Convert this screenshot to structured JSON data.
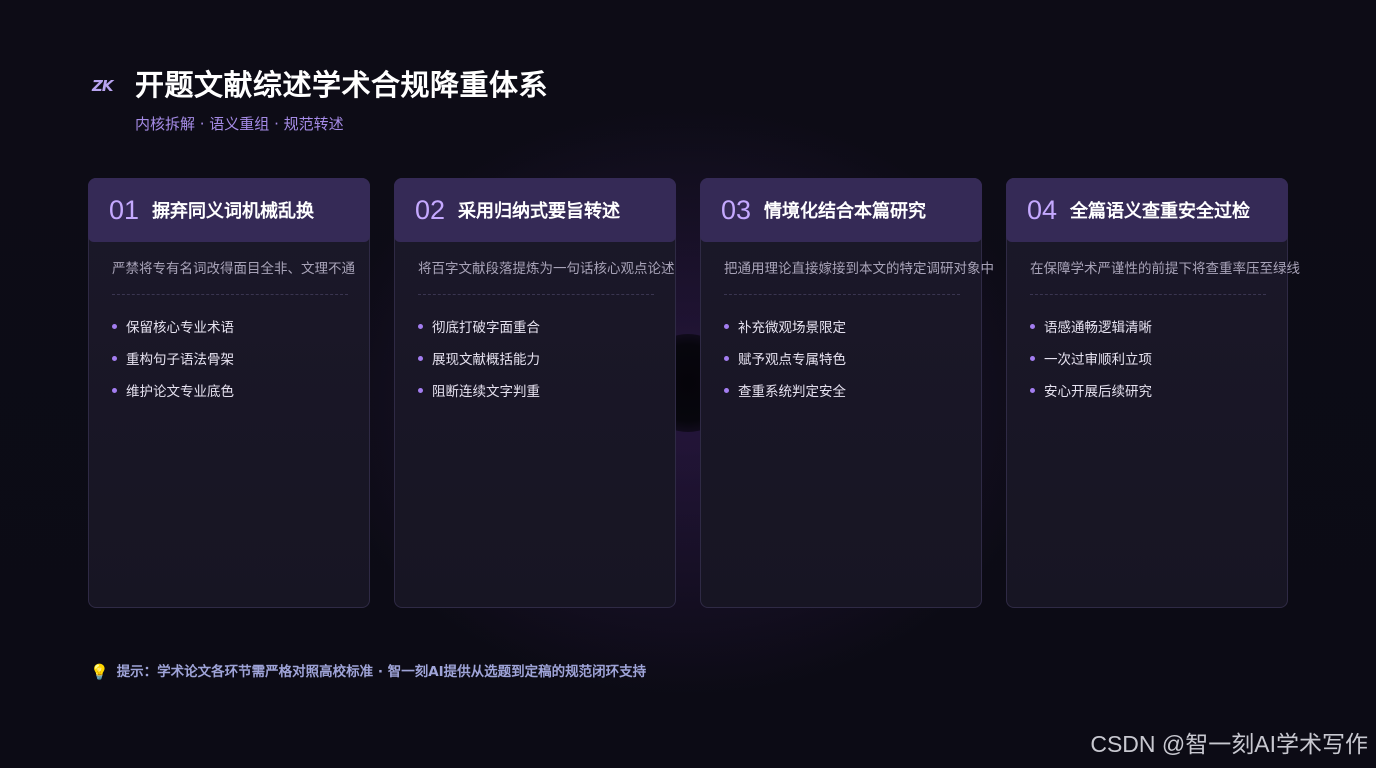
{
  "header": {
    "logo": "ZK",
    "title": "开题文献综述学术合规降重体系",
    "subtitle": "内核拆解 · 语义重组 · 规范转述"
  },
  "cards": [
    {
      "num": "01",
      "title": "摒弃同义词机械乱换",
      "desc": "严禁将专有名词改得面目全非、文理不通",
      "points": [
        "保留核心专业术语",
        "重构句子语法骨架",
        "维护论文专业底色"
      ]
    },
    {
      "num": "02",
      "title": "采用归纳式要旨转述",
      "desc": "将百字文献段落提炼为一句话核心观点论述",
      "points": [
        "彻底打破字面重合",
        "展现文献概括能力",
        "阻断连续文字判重"
      ]
    },
    {
      "num": "03",
      "title": "情境化结合本篇研究",
      "desc": "把通用理论直接嫁接到本文的特定调研对象中",
      "points": [
        "补充微观场景限定",
        "赋予观点专属特色",
        "查重系统判定安全"
      ]
    },
    {
      "num": "04",
      "title": "全篇语义查重安全过检",
      "desc": "在保障学术严谨性的前提下将查重率压至绿线",
      "points": [
        "语感通畅逻辑清晰",
        "一次过审顺利立项",
        "安心开展后续研究"
      ]
    }
  ],
  "tip": {
    "icon": "lightbulb-icon",
    "text": "提示：学术论文各环节需严格对照高校标准 · 智一刻AI提供从选题到定稿的规范闭环支持"
  },
  "watermark": "CSDN @智一刻AI学术写作",
  "colors": {
    "background": "#0d0c16",
    "card_header": "#352a56",
    "accent": "#c5a9ff",
    "bullet": "#a37df0",
    "subtitle": "#a58be6"
  }
}
